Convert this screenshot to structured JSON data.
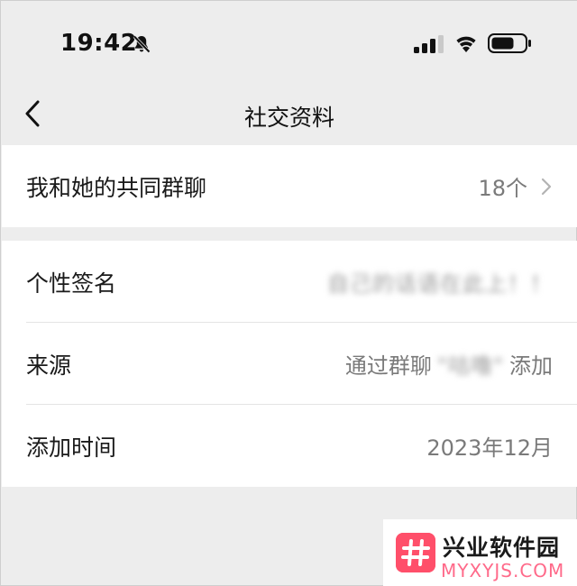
{
  "status_bar": {
    "time": "19:42",
    "icons": [
      "bell-slash-icon",
      "signal-icon",
      "wifi-icon",
      "battery-icon"
    ]
  },
  "nav": {
    "title": "社交资料",
    "back_icon": "chevron-left-icon"
  },
  "section_groups": {
    "label": "我和她的共同群聊",
    "value": "18个"
  },
  "section_info": [
    {
      "label": "个性签名",
      "value_obscured": "自己的话语在此上！！"
    },
    {
      "label": "来源",
      "value_prefix": "通过群聊",
      "value_obscured": "\"咕噜\"",
      "value_suffix": "添加"
    },
    {
      "label": "添加时间",
      "value": "2023年12月"
    }
  ],
  "watermark": {
    "name": "兴业软件园",
    "url": "MYXYJS.COM",
    "logo_color": "#ff4f6a"
  },
  "colors": {
    "background": "#ededed",
    "card": "#ffffff",
    "secondary_text": "#7a7a7a"
  }
}
